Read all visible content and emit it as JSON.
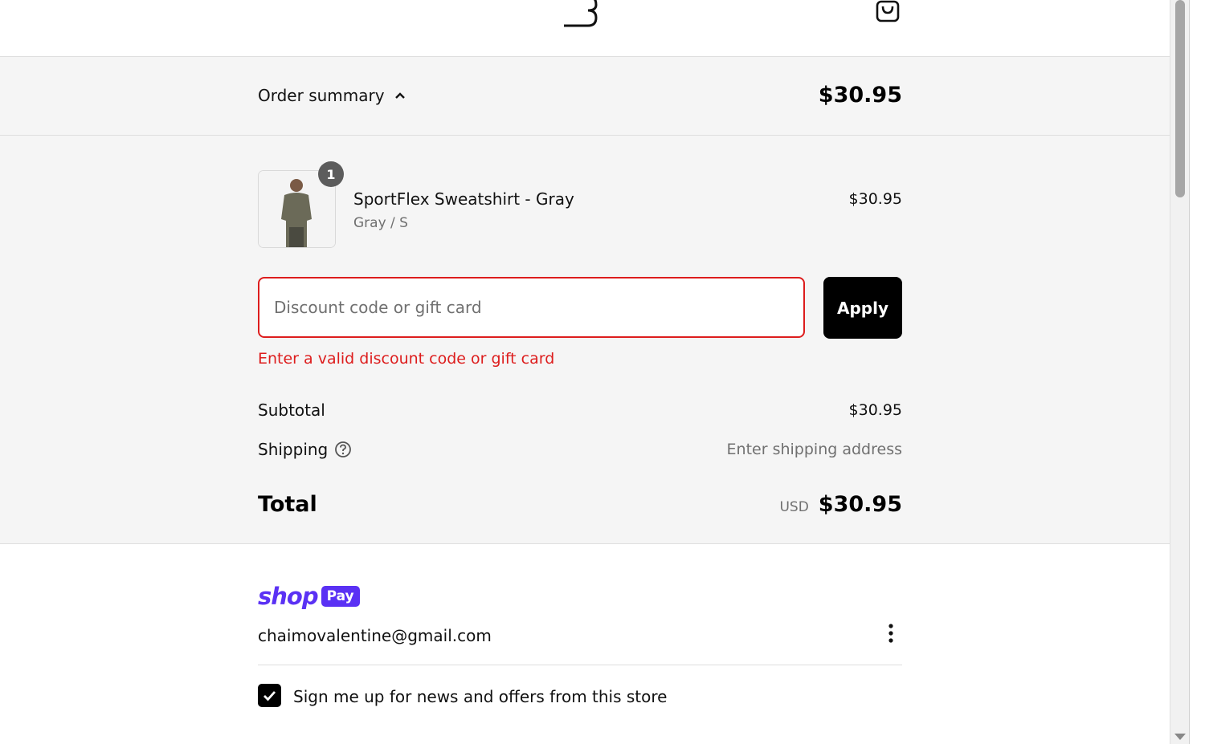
{
  "header": {
    "logo_icon": "brand-logo-icon",
    "cart_icon": "shopping-bag-icon"
  },
  "summary": {
    "toggle_label": "Order summary",
    "toggle_icon": "chevron-up-icon",
    "total": "$30.95"
  },
  "item": {
    "quantity": "1",
    "name": "SportFlex Sweatshirt - Gray",
    "variant": "Gray / S",
    "price": "$30.95"
  },
  "discount": {
    "placeholder": "Discount code or gift card",
    "value": "",
    "apply_label": "Apply",
    "error": "Enter a valid discount code or gift card"
  },
  "totals": {
    "subtotal_label": "Subtotal",
    "subtotal_value": "$30.95",
    "shipping_label": "Shipping",
    "shipping_value": "Enter shipping address",
    "total_label": "Total",
    "currency": "USD",
    "total_value": "$30.95"
  },
  "shop_pay": {
    "brand_word": "shop",
    "brand_pill": "Pay",
    "email": "chaimovalentine@gmail.com",
    "newsletter_label": "Sign me up for news and offers from this store",
    "newsletter_checked": true
  },
  "colors": {
    "error": "#dd1d1d",
    "shop_pay_purple": "#5a31f4",
    "band_bg": "#f5f5f5"
  }
}
